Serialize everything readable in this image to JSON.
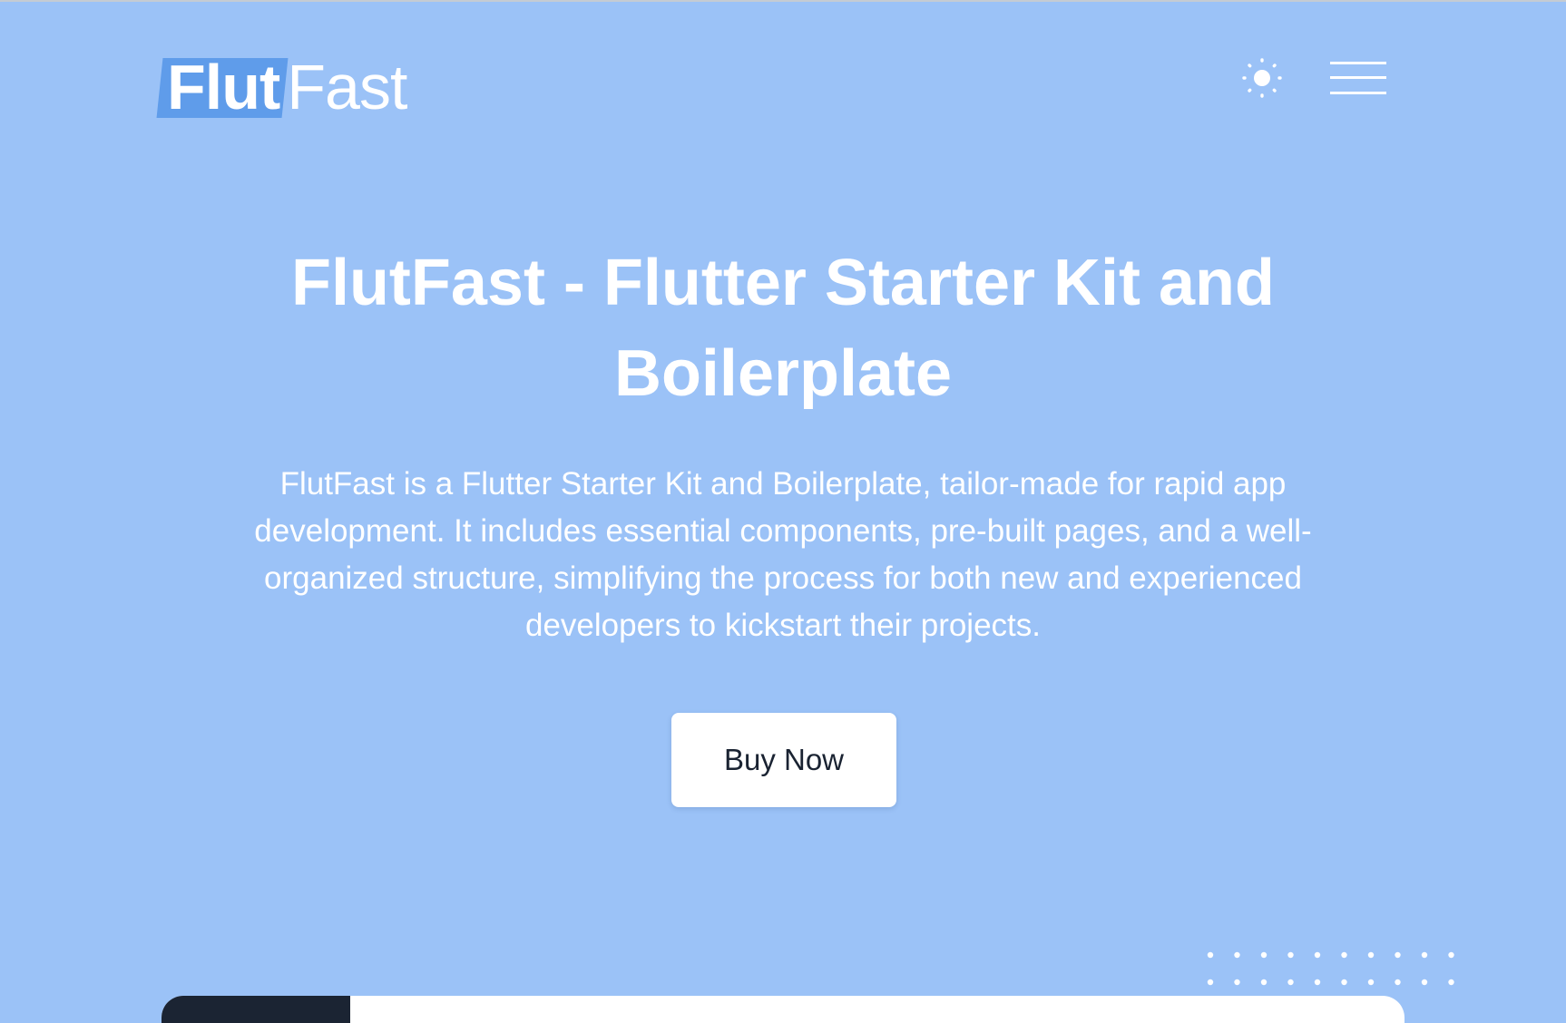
{
  "brand": {
    "logo_part1": "Flut",
    "logo_part2": "Fast",
    "accent_color": "#5f9cea"
  },
  "header": {
    "theme_toggle_icon": "sun-icon",
    "menu_icon": "hamburger-menu-icon"
  },
  "hero": {
    "title": "FlutFast - Flutter Starter Kit and Boilerplate",
    "description": "FlutFast is a Flutter Starter Kit and Boilerplate, tailor-made for rapid app development. It includes essential components, pre-built pages, and a well-organized structure, simplifying the process for both new and experienced developers to kickstart their projects.",
    "cta_label": "Buy Now"
  },
  "colors": {
    "background": "#9bc2f7",
    "text": "#ffffff",
    "button_bg": "#ffffff",
    "button_text": "#1a2332"
  }
}
